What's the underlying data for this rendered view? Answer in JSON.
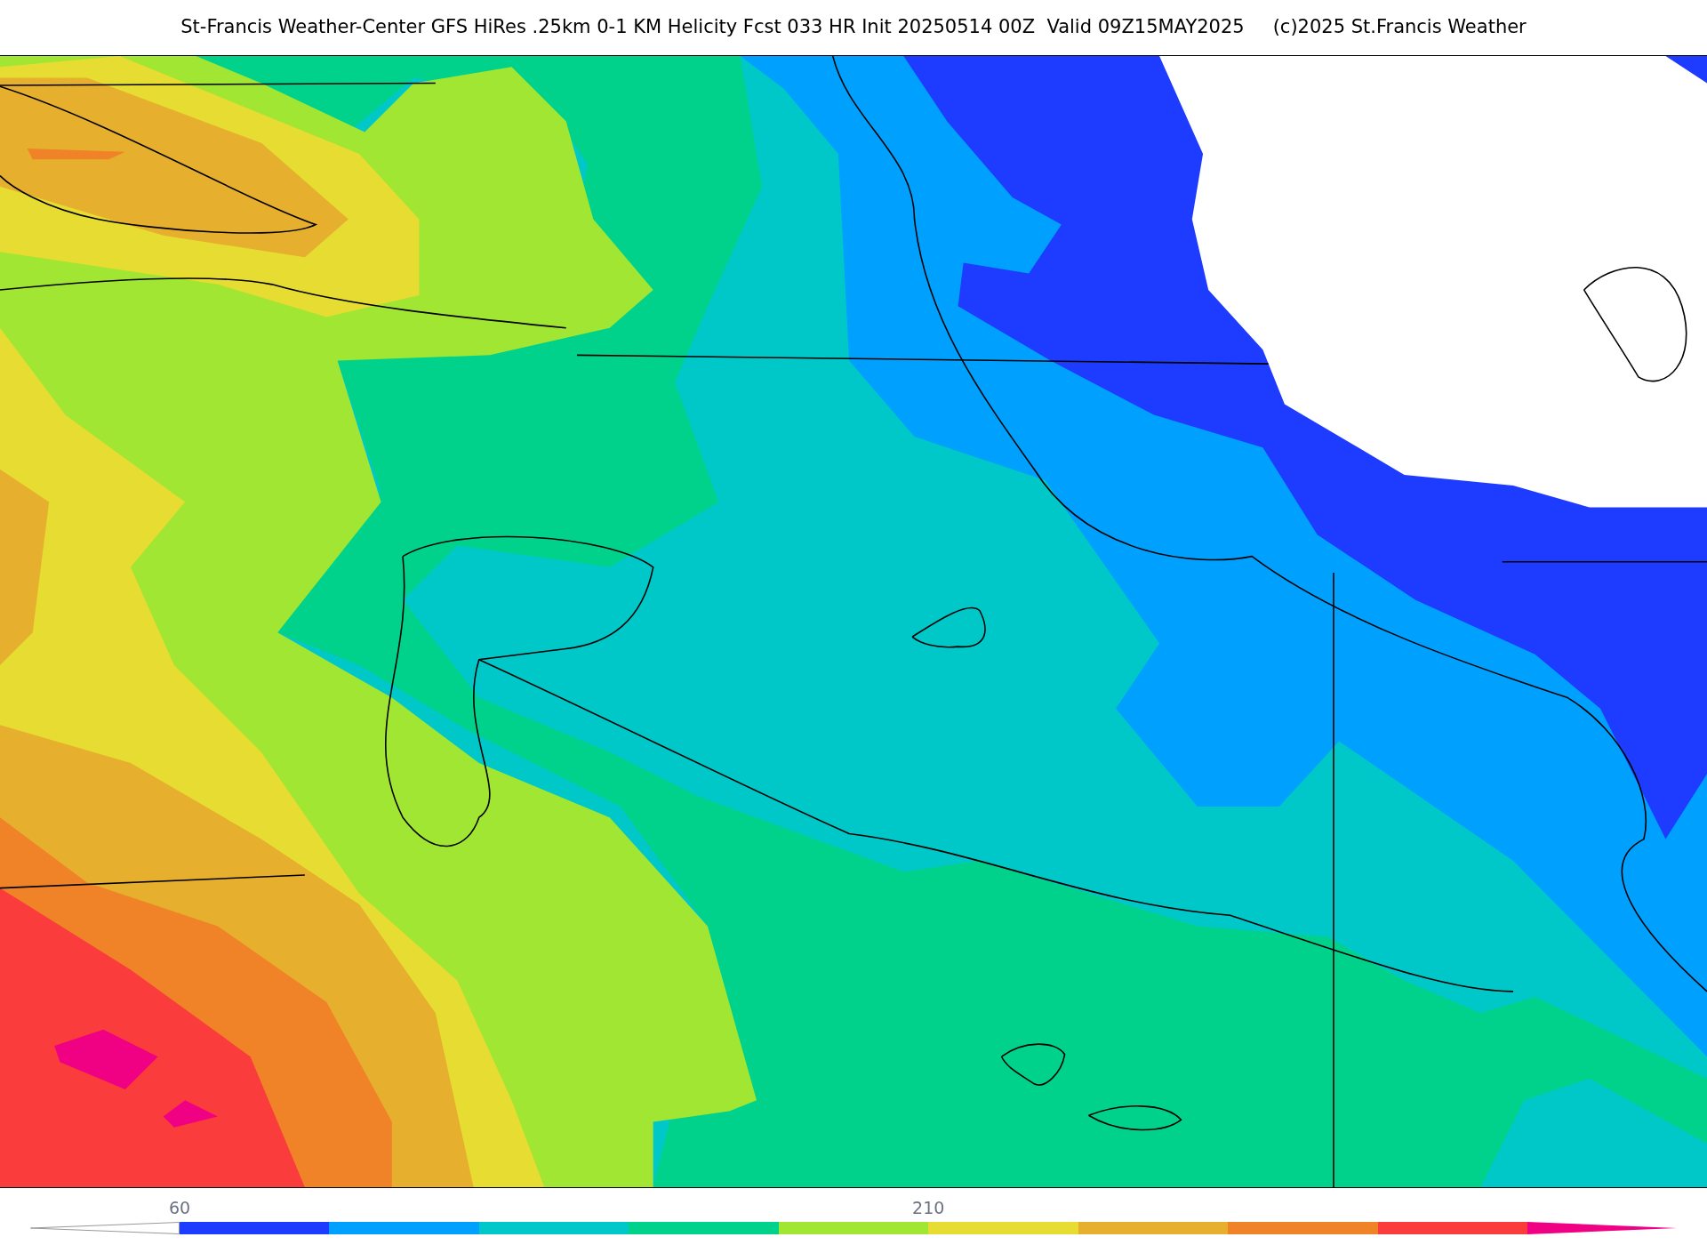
{
  "header": {
    "title": "St-Francis Weather-Center GFS HiRes .25km 0-1 KM Helicity Fcst 033 HR Init 20250514 00Z  Valid 09Z15MAY2025",
    "credit": "(c)2025 St.Francis Weather"
  },
  "colorbar": {
    "segments": [
      {
        "kind": "under",
        "color": "#ffffff"
      },
      {
        "kind": "band",
        "color": "#1e3cff"
      },
      {
        "kind": "band",
        "color": "#00a0ff"
      },
      {
        "kind": "band",
        "color": "#00c8c8"
      },
      {
        "kind": "band",
        "color": "#00d28c"
      },
      {
        "kind": "band",
        "color": "#a0e632"
      },
      {
        "kind": "band",
        "color": "#e6dc32"
      },
      {
        "kind": "band",
        "color": "#e6af2d"
      },
      {
        "kind": "band",
        "color": "#f08228"
      },
      {
        "kind": "band",
        "color": "#fa3c3c"
      },
      {
        "kind": "over",
        "color": "#f00082"
      }
    ],
    "tick_labels": [
      "60",
      "210"
    ]
  }
}
